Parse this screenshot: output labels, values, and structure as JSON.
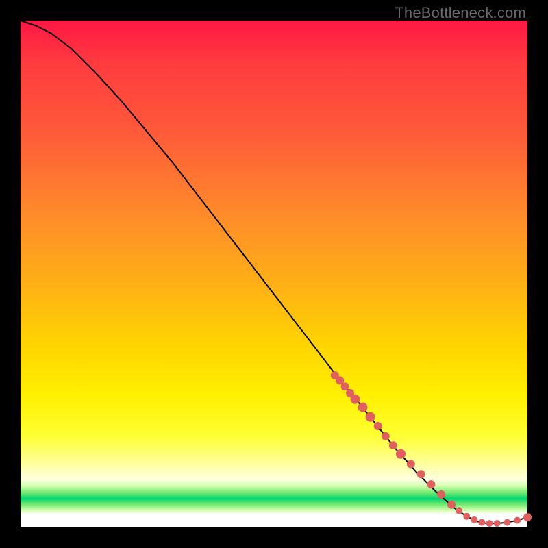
{
  "watermark": "TheBottleneck.com",
  "colors": {
    "background": "#000000",
    "curve": "#000000",
    "marker": "#e06060"
  },
  "chart_data": {
    "type": "line",
    "title": "",
    "xlabel": "",
    "ylabel": "",
    "xlim": [
      0,
      100
    ],
    "ylim": [
      0,
      100
    ],
    "grid": false,
    "note": "No axis ticks or numeric labels are rendered; values are proportional to plot area (0–100).",
    "series": [
      {
        "name": "bottleneck-curve",
        "x": [
          0,
          3,
          6,
          10,
          15,
          20,
          25,
          30,
          35,
          40,
          45,
          50,
          55,
          60,
          63,
          66,
          68,
          70,
          72,
          74,
          76,
          78,
          80,
          82,
          84,
          86,
          88,
          90,
          92,
          94,
          96,
          98,
          100
        ],
        "y": [
          100,
          99,
          97.5,
          94.5,
          89.5,
          84,
          78,
          72,
          65.5,
          59,
          52.5,
          46,
          39.5,
          33,
          29,
          25.5,
          23,
          20.5,
          18,
          15.5,
          13.3,
          11,
          9,
          7,
          5.2,
          3.5,
          2.2,
          1.2,
          0.8,
          0.8,
          1.0,
          1.4,
          2.0
        ]
      }
    ],
    "markers": {
      "name": "highlighted-points",
      "x": [
        62,
        63,
        64,
        65,
        66,
        67.5,
        69,
        70.5,
        72,
        73.5,
        75,
        77,
        79,
        81,
        83,
        85,
        86.5,
        88,
        89.5,
        91,
        92.5,
        94,
        96,
        98,
        100
      ],
      "y": [
        30,
        29,
        27.8,
        26.5,
        25.3,
        23.7,
        21.8,
        20,
        18,
        16.2,
        14.5,
        12.5,
        10.5,
        8.5,
        6.5,
        4.5,
        3.3,
        2.2,
        1.5,
        1.0,
        0.8,
        0.8,
        1.0,
        1.4,
        2.0
      ],
      "r": [
        6,
        6,
        6,
        6,
        7,
        7,
        7,
        6,
        6,
        6,
        7,
        6,
        6,
        6,
        6,
        6,
        5,
        5,
        5,
        5,
        5,
        5,
        5,
        5,
        6
      ]
    }
  }
}
